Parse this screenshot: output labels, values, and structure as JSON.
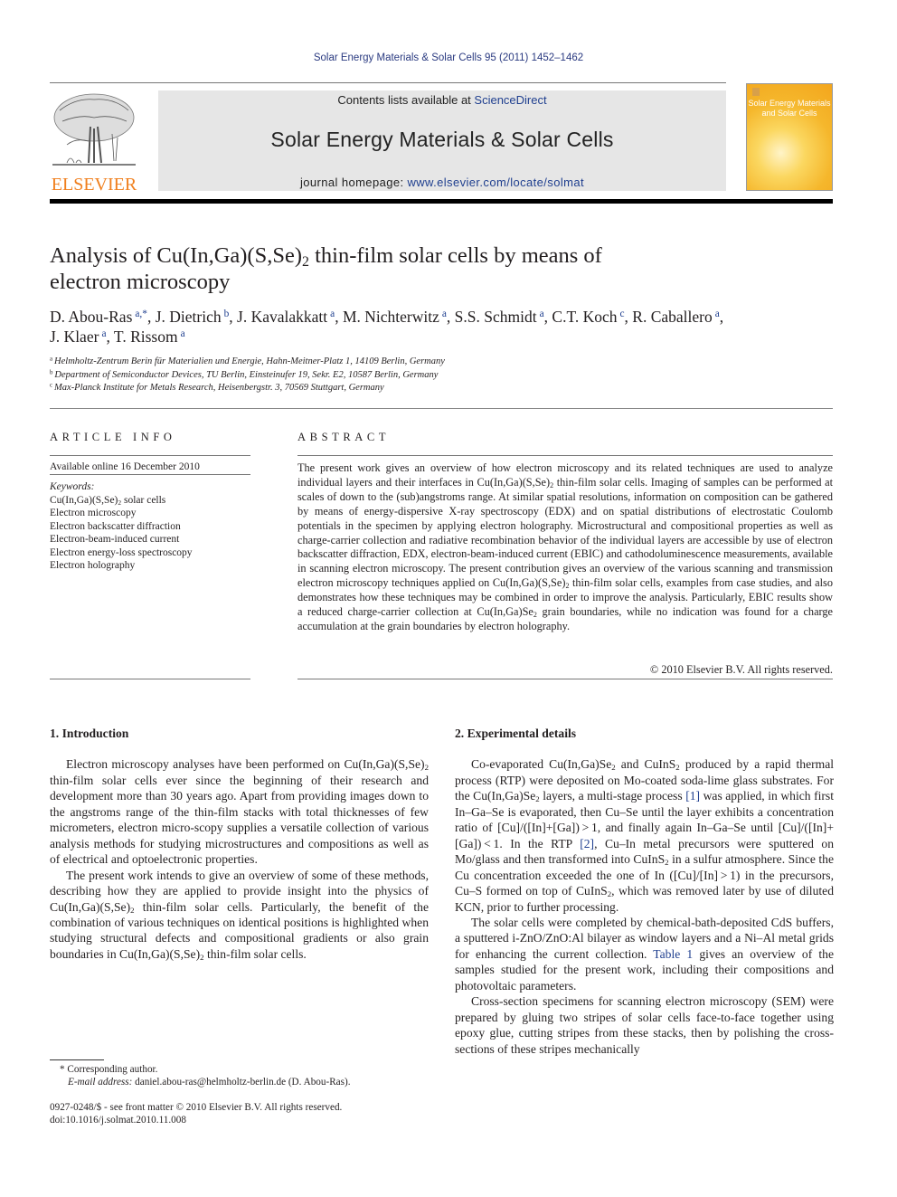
{
  "header": {
    "running_head": "Solar Energy Materials & Solar Cells 95 (2011) 1452–1462",
    "contents_prefix": "Contents lists available at ",
    "contents_link": "ScienceDirect",
    "journal_name": "Solar Energy Materials & Solar Cells",
    "homepage_prefix": "journal homepage: ",
    "homepage_link": "www.elsevier.com/locate/solmat",
    "publisher_logo_text": "ELSEVIER",
    "cover_title_line1": "Solar Energy Materials",
    "cover_title_line2": "and Solar Cells"
  },
  "article": {
    "title_part1": "Analysis of Cu(In,Ga)(S,Se)",
    "title_sub": "2",
    "title_part2": " thin-film solar cells by means of",
    "title_line2": "electron microscopy",
    "authors": [
      {
        "name": "D. Abou-Ras",
        "sup": "a,*",
        "sep": ", "
      },
      {
        "name": "J. Dietrich",
        "sup": "b",
        "sep": ", "
      },
      {
        "name": "J. Kavalakkatt",
        "sup": "a",
        "sep": ", "
      },
      {
        "name": "M. Nichterwitz",
        "sup": "a",
        "sep": ", "
      },
      {
        "name": "S.S. Schmidt",
        "sup": "a",
        "sep": ", "
      },
      {
        "name": "C.T. Koch",
        "sup": "c",
        "sep": ", "
      },
      {
        "name": "R. Caballero",
        "sup": "a",
        "sep": ","
      },
      {
        "name": "J. Klaer",
        "sup": "a",
        "sep": ", "
      },
      {
        "name": "T. Rissom",
        "sup": "a",
        "sep": ""
      }
    ],
    "affiliations": [
      {
        "sup": "a",
        "text": "Helmholtz-Zentrum Berin für Materialien und Energie, Hahn-Meitner-Platz 1, 14109 Berlin, Germany"
      },
      {
        "sup": "b",
        "text": "Department of Semiconductor Devices, TU Berlin, Einsteinufer 19, Sekr. E2, 10587 Berlin, Germany"
      },
      {
        "sup": "c",
        "text": "Max-Planck Institute for Metals Research, Heisenbergstr. 3, 70569 Stuttgart, Germany"
      }
    ]
  },
  "article_info": {
    "heading": "ARTICLE INFO",
    "available_online": "Available online 16 December 2010",
    "keywords_label": "Keywords:",
    "keyword1_a": "Cu(In,Ga)(S,Se)",
    "keyword1_sub": "2",
    "keyword1_b": " solar cells",
    "keywords": [
      "Electron microscopy",
      "Electron backscatter diffraction",
      "Electron-beam-induced current",
      "Electron energy-loss spectroscopy",
      "Electron holography"
    ]
  },
  "abstract": {
    "heading": "ABSTRACT",
    "p1": "The present work gives an overview of how electron microscopy and its related techniques are used to analyze individual layers and their interfaces in Cu(In,Ga)(S,Se)",
    "p2": " thin-film solar cells. Imaging of samples can be performed at scales of down to the (sub)angstroms range. At similar spatial resolutions, information on composition can be gathered by means of energy-dispersive X-ray spectroscopy (EDX) and on spatial distributions of electrostatic Coulomb potentials in the specimen by applying electron holography. Microstructural and compositional properties as well as charge-carrier collection and radiative recombination behavior of the individual layers are accessible by use of electron backscatter diffraction, EDX, electron-beam-induced current (EBIC) and cathodoluminescence measurements, available in scanning electron microscopy. The present contribution gives an overview of the various scanning and transmission electron microscopy techniques applied on Cu(In,Ga)(S,Se)",
    "p3": " thin-film solar cells, examples from case studies, and also demonstrates how these techniques may be combined in order to improve the analysis. Particularly, EBIC results show a reduced charge-carrier collection at Cu(In,Ga)Se",
    "p4": " grain boundaries, while no indication was found for a charge accumulation at the grain boundaries by electron holography.",
    "sub": "2",
    "copyright": "© 2010 Elsevier B.V. All rights reserved."
  },
  "intro": {
    "heading": "1.  Introduction",
    "para1_a": "Electron microscopy analyses have been performed on Cu(In,Ga)(S,Se)",
    "para1_b": " thin-film solar cells ever since the beginning of their research and development more than 30 years ago. Apart from providing images down to the angstroms range of the thin-film stacks with total thicknesses of few micrometers, electron micro-scopy supplies a versatile collection of various analysis methods for studying microstructures and compositions as well as of electrical and optoelectronic properties.",
    "para2_a": "The present work intends to give an overview of some of these methods, describing how they are applied to provide insight into the physics of Cu(In,Ga)(S,Se)",
    "para2_b": " thin-film solar cells. Particularly, the benefit of the combination of various techniques on identical positions is highlighted when studying structural defects and compositional gradients or also grain boundaries in Cu(In,Ga)(S,Se)",
    "para2_c": " thin-film solar cells.",
    "sub": "2"
  },
  "experimental": {
    "heading": "2.  Experimental details",
    "p1_a": "Co-evaporated Cu(In,Ga)Se",
    "p1_b": " and CuInS",
    "p1_c": " produced by a rapid thermal process (RTP) were deposited on Mo-coated soda-lime glass substrates. For the Cu(In,Ga)Se",
    "p1_d": " layers, a multi-stage process ",
    "ref1": "[1]",
    "p1_e": " was applied, in which first In–Ga–Se is evaporated, then Cu–Se until the layer exhibits a concentration ratio of [Cu]/([In]+[Ga]) > 1, and finally again In–Ga–Se until [Cu]/([In]+[Ga]) < 1. In the RTP ",
    "ref2": "[2]",
    "p1_f": ", Cu–In metal precursors were sputtered on Mo/glass and then transformed into CuInS",
    "p1_g": " in a sulfur atmosphere. Since the Cu concentration exceeded the one of In ([Cu]/[In] > 1) in the precursors, Cu–S formed on top of CuInS",
    "p1_h": ", which was removed later by use of diluted KCN, prior to further processing.",
    "p2_a": "The solar cells were completed by chemical-bath-deposited CdS buffers, a sputtered i-ZnO/ZnO:Al bilayer as window layers and a Ni–Al metal grids for enhancing the current collection. ",
    "table_ref": "Table 1",
    "p2_b": " gives an overview of the samples studied for the present work, including their compositions and photovoltaic parameters.",
    "p3": "Cross-section specimens for scanning electron microscopy (SEM) were prepared by gluing two stripes of solar cells face-to-face together using epoxy glue, cutting stripes from these stacks, then by polishing the cross-sections of these stripes mechanically",
    "sub": "2"
  },
  "footnotes": {
    "corresponding": "* Corresponding author.",
    "email_label": "E-mail address:",
    "email": " daniel.abou-ras@helmholtz-berlin.de (D. Abou-Ras).",
    "issn": "0927-0248/$ - see front matter © 2010 Elsevier B.V. All rights reserved.",
    "doi": "doi:10.1016/j.solmat.2010.11.008"
  }
}
